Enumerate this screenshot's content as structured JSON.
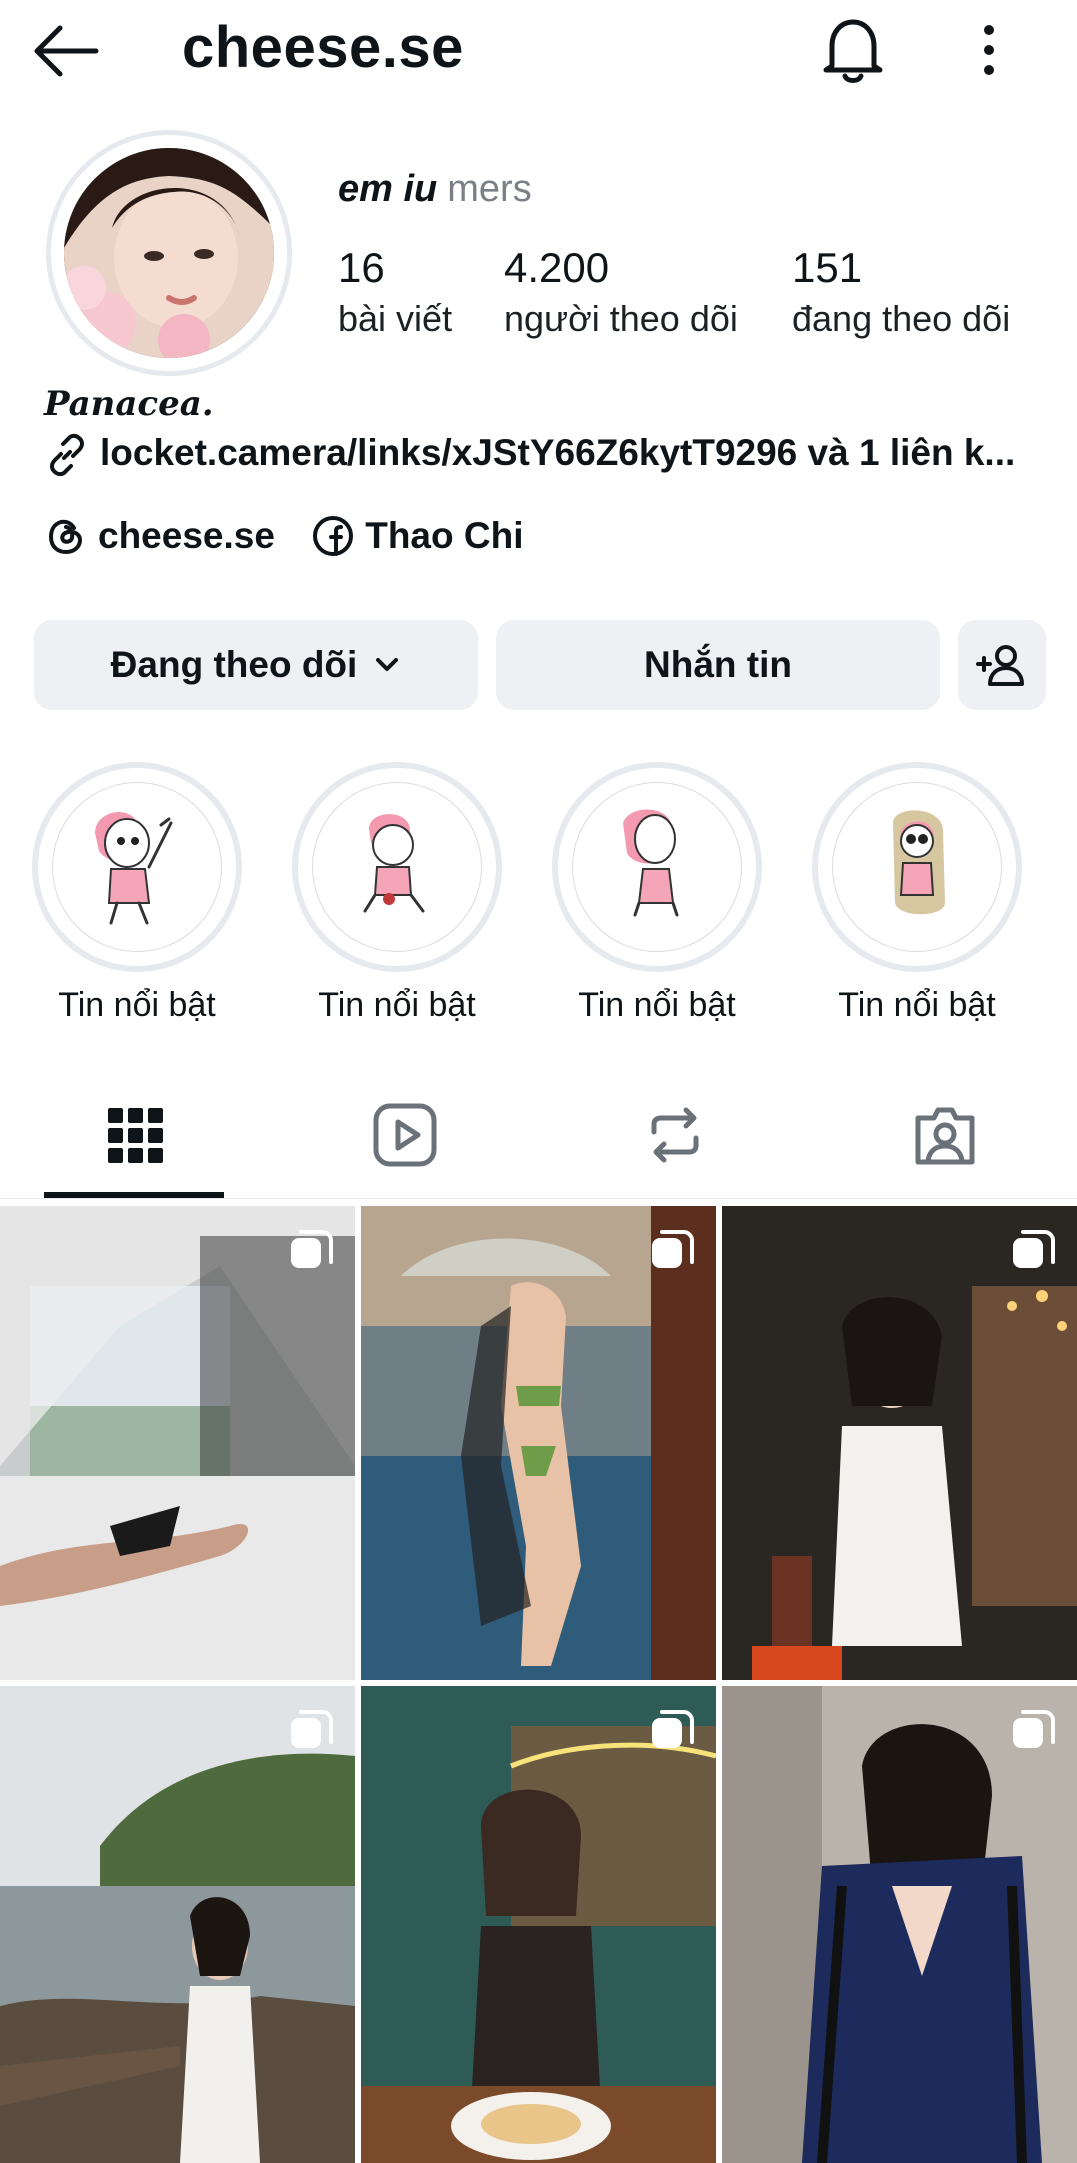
{
  "header": {
    "username": "cheese.se",
    "back_icon": "arrow-left-icon",
    "bell_icon": "bell-icon",
    "more_icon": "more-vertical-icon"
  },
  "profile": {
    "display_name": "em iu",
    "pronouns": "mers",
    "stats": [
      {
        "value": "16",
        "label": "bài viết"
      },
      {
        "value": "4.200",
        "label": "người theo dõi"
      },
      {
        "value": "151",
        "label": "đang theo dõi"
      }
    ],
    "bio": "Panacea.",
    "link": "locket.camera/links/xJStY66Z6kytT9296 và 1 liên k...",
    "socials": [
      {
        "icon": "threads-icon",
        "label": "cheese.se"
      },
      {
        "icon": "facebook-icon",
        "label": "Thao Chi"
      }
    ]
  },
  "actions": {
    "following_label": "Đang theo dõi",
    "message_label": "Nhắn tin",
    "add_user_icon": "add-user-icon"
  },
  "highlights": [
    {
      "label": "Tin nổi bật"
    },
    {
      "label": "Tin nổi bật"
    },
    {
      "label": "Tin nổi bật"
    },
    {
      "label": "Tin nổi bật"
    }
  ],
  "tabs": [
    {
      "icon": "grid-icon",
      "selected": true
    },
    {
      "icon": "reels-icon",
      "selected": false
    },
    {
      "icon": "repost-icon",
      "selected": false
    },
    {
      "icon": "tagged-icon",
      "selected": false
    }
  ],
  "grid_badge_icon": "multi-image-icon",
  "colors": {
    "text": "#0f1419",
    "muted": "#7b8087",
    "button_bg": "#eef0f3",
    "ring": "#e6e9ee"
  }
}
